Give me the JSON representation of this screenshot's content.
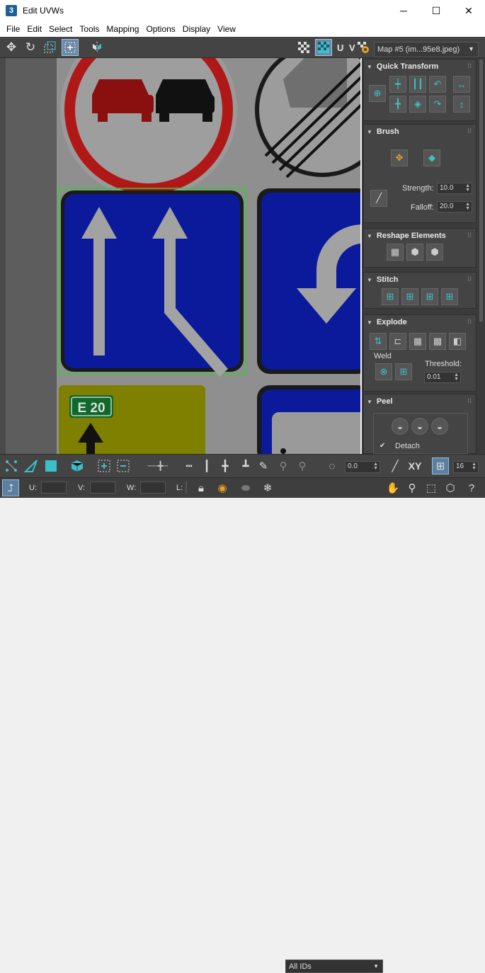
{
  "window": {
    "app_icon": "3",
    "title": "Edit UVWs",
    "minimize": "─",
    "maximize": "☐",
    "close": "✕"
  },
  "menu": [
    "File",
    "Edit",
    "Select",
    "Tools",
    "Mapping",
    "Options",
    "Display",
    "View"
  ],
  "toolbar": {
    "uv_label": "U V",
    "map_select": "Map #5 (im...95e8.jpeg)"
  },
  "texture": {
    "lane_sign_label": "E 20"
  },
  "panel": {
    "quick_transform": {
      "title": "Quick Transform"
    },
    "brush": {
      "title": "Brush",
      "strength_label": "Strength:",
      "strength_value": "10.0",
      "falloff_label": "Falloff:",
      "falloff_value": "20.0"
    },
    "reshape": {
      "title": "Reshape Elements"
    },
    "stitch": {
      "title": "Stitch"
    },
    "explode": {
      "title": "Explode",
      "weld_label": "Weld",
      "threshold_label": "Threshold:",
      "threshold_value": "0.01"
    },
    "peel": {
      "title": "Peel",
      "detach_label": "Detach",
      "detach_checked": "✔"
    }
  },
  "bottom": {
    "rotate_value": "0.0",
    "xy_label": "XY",
    "grid_value": "16",
    "u_label": "U:",
    "v_label": "V:",
    "w_label": "W:",
    "l_label": "L:",
    "ids_select": "All IDs"
  },
  "colors": {
    "accent": "#3cc0c8",
    "panel_bg": "#444444",
    "viewport_bg": "#7e7e7e",
    "active_btn": "#6c88a6"
  }
}
